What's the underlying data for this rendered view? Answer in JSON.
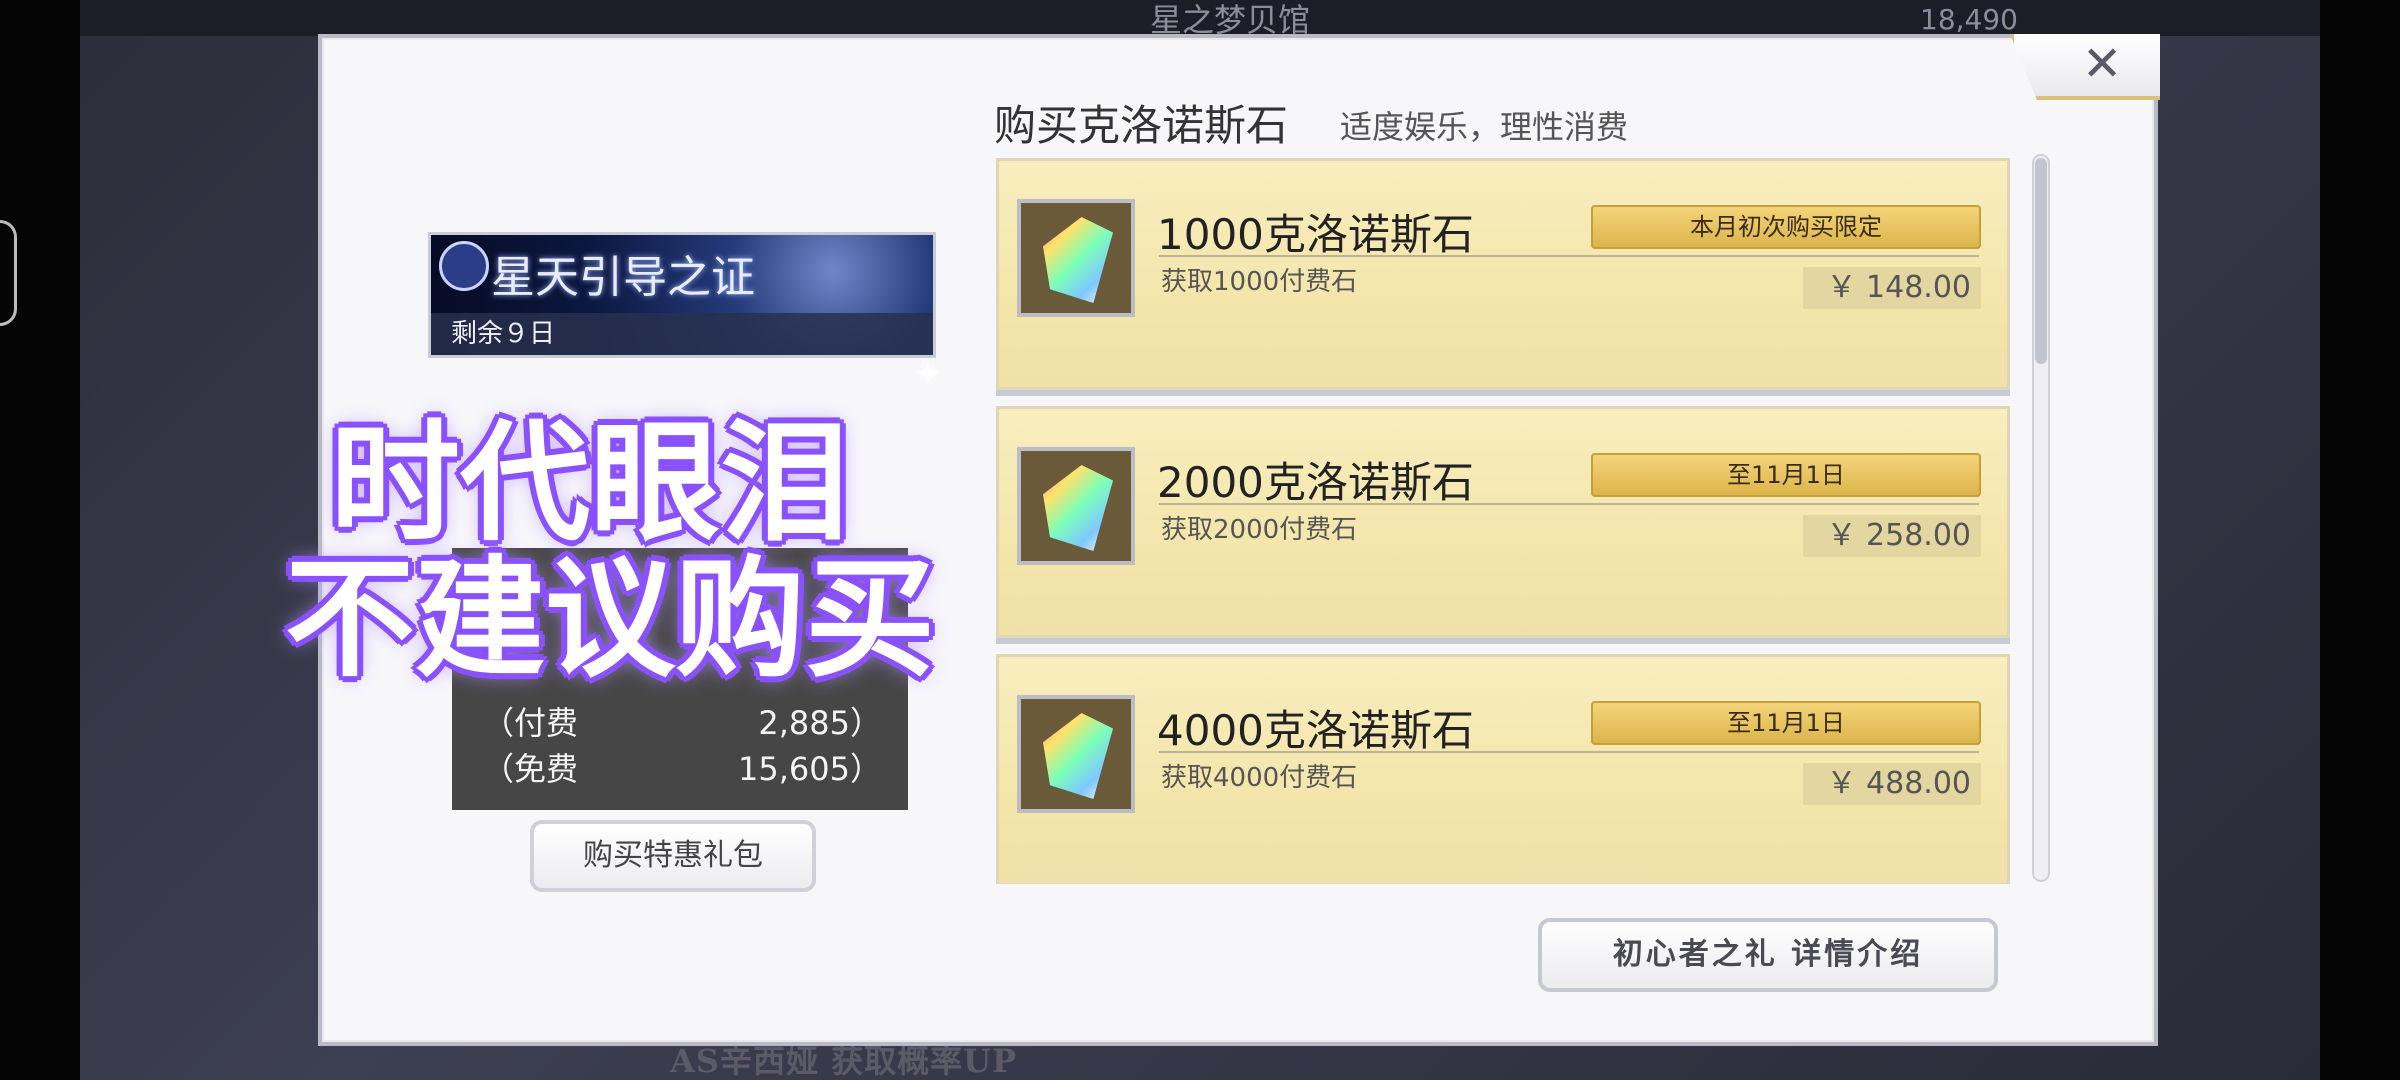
{
  "background": {
    "title": "星之梦贝馆",
    "currency_count": "18,490",
    "bottom_banner": "AS辛西娅 获取概率UP"
  },
  "dialog": {
    "close_icon": "close-icon"
  },
  "left_panel": {
    "banner": {
      "title": "星天引导之证",
      "remaining": "剩余９日"
    },
    "balance": {
      "paid_label": "（付费",
      "paid_value": "2,885）",
      "free_label": "（免费",
      "free_value": "15,605）"
    },
    "gift_button": "购买特惠礼包"
  },
  "overlay": {
    "line1": "时代眼泪",
    "line2": "不建议购买",
    "outline_color": "#8b52ff"
  },
  "shop": {
    "title": "购买克洛诺斯石",
    "subtitle": "适度娱乐，理性消费",
    "products": [
      {
        "name": "1000克洛诺斯石",
        "desc": "获取1000付费石",
        "tag": "本月初次购买限定",
        "price": "￥ 148.00",
        "icon": "chronos-stone-icon"
      },
      {
        "name": "2000克洛诺斯石",
        "desc": "获取2000付费石",
        "tag": "至11月1日",
        "price": "￥ 258.00",
        "icon": "chronos-stone-icon"
      },
      {
        "name": "4000克洛诺斯石",
        "desc": "获取4000付费石",
        "tag": "至11月1日",
        "price": "￥ 488.00",
        "icon": "chronos-stone-icon"
      }
    ],
    "info_button": "初心者之礼 详情介绍"
  }
}
